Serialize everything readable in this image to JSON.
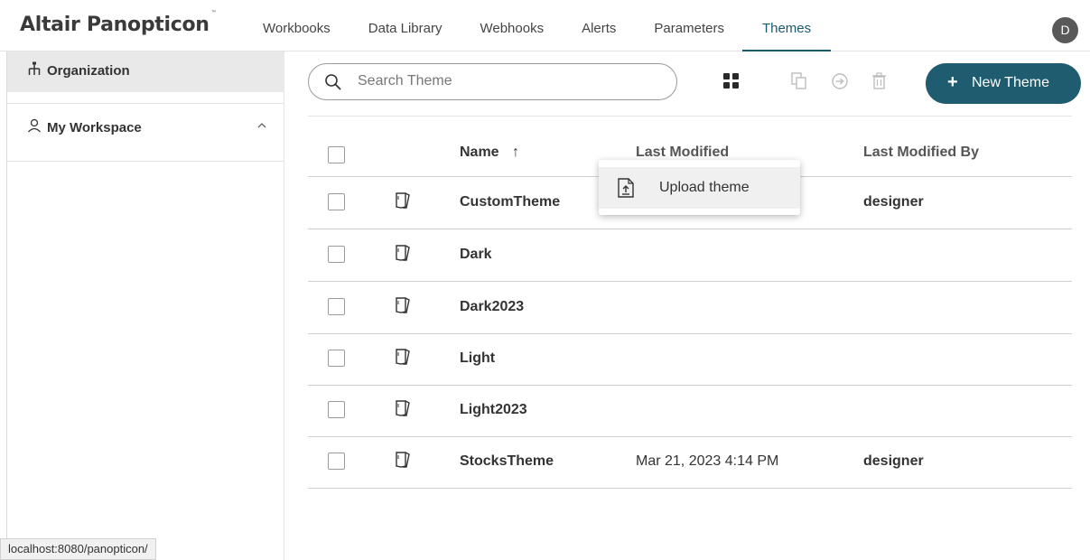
{
  "app": {
    "name": "Altair Panopticon",
    "trademark": "™"
  },
  "nav": {
    "items": [
      {
        "label": "Workbooks"
      },
      {
        "label": "Data Library"
      },
      {
        "label": "Webhooks"
      },
      {
        "label": "Alerts"
      },
      {
        "label": "Parameters"
      },
      {
        "label": "Themes",
        "active": true
      }
    ]
  },
  "user": {
    "avatar_initial": "D"
  },
  "sidebar": {
    "organization_label": "Organization",
    "workspace_label": "My Workspace"
  },
  "toolbar": {
    "search_placeholder": "Search Theme",
    "new_button_label": "New Theme",
    "new_button_icon": "plus-icon"
  },
  "table": {
    "headers": {
      "name": "Name",
      "sort_indicator": "↑",
      "last_modified": "Last Modified",
      "last_modified_by": "Last Modified By"
    },
    "rows": [
      {
        "name": "CustomTheme",
        "last_modified": "",
        "last_modified_by": "designer"
      },
      {
        "name": "Dark",
        "last_modified": "",
        "last_modified_by": ""
      },
      {
        "name": "Dark2023",
        "last_modified": "",
        "last_modified_by": ""
      },
      {
        "name": "Light",
        "last_modified": "",
        "last_modified_by": ""
      },
      {
        "name": "Light2023",
        "last_modified": "",
        "last_modified_by": ""
      },
      {
        "name": "StocksTheme",
        "last_modified": "Mar 21, 2023 4:14 PM",
        "last_modified_by": "designer"
      }
    ]
  },
  "popup": {
    "upload_label": "Upload theme"
  },
  "statusbar": {
    "url": "localhost:8080/panopticon/"
  },
  "colors": {
    "accent": "#1f5c6f",
    "avatar_bg": "#595959",
    "selected_row_bg": "#e9e9e9"
  }
}
